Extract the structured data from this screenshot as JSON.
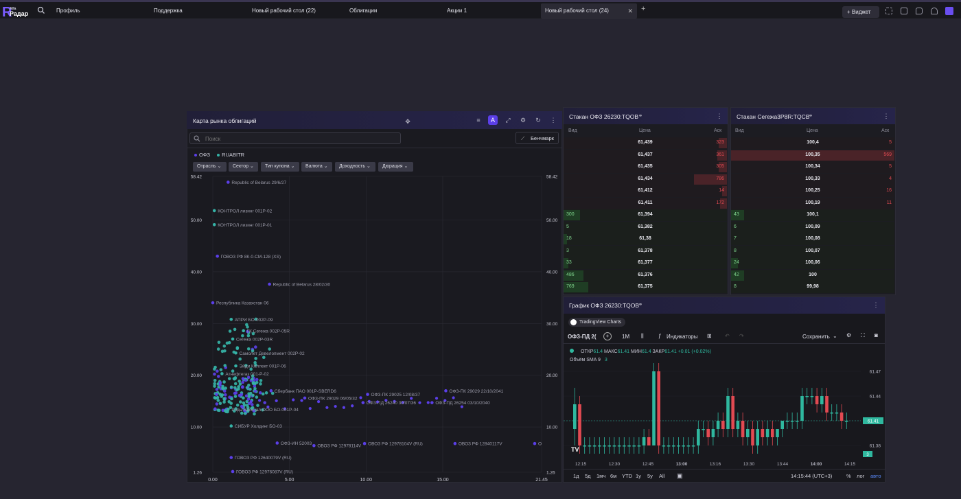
{
  "topbar": {
    "logo_small": "Alfa",
    "logo_big": "Радар",
    "tabs": [
      {
        "label": "Профиль",
        "active": false
      },
      {
        "label": "Поддержка",
        "active": false
      },
      {
        "label": "Новый рабочий стол (22)",
        "active": false
      },
      {
        "label": "Облигации",
        "active": false
      },
      {
        "label": "Акции 1",
        "active": false
      },
      {
        "label": "Новый рабочий стол (24)",
        "active": true
      }
    ],
    "add_tab": "+",
    "widget_button": "+  Виджет"
  },
  "bond_map": {
    "title": "Карта рынка облигаций",
    "search_placeholder": "Поиск",
    "benchmark_label": "Бенчмарк",
    "legend": [
      {
        "name": "ОФЗ",
        "color": "#5b3fe8"
      },
      {
        "name": "RUABITR",
        "color": "#35b2a6"
      }
    ],
    "filters": [
      "Отрасль",
      "Сектор",
      "Тип купона",
      "Валюта",
      "Доходность",
      "Дюрация"
    ]
  },
  "chart_data": {
    "type": "scatter",
    "title": "Карта рынка облигаций",
    "xlim": [
      0,
      21.45
    ],
    "ylim": [
      1.26,
      58.42
    ],
    "x_ticks": [
      "0.00",
      "5.00",
      "10.00",
      "15.00",
      "21.45"
    ],
    "y_ticks": [
      "1.26",
      "10.00",
      "20.00",
      "30.00",
      "40.00",
      "50.00",
      "58.42"
    ],
    "grid": true,
    "series": [
      {
        "name": "ОФЗ",
        "color": "#5b3fe8"
      },
      {
        "name": "RUABITR",
        "color": "#35b2a6"
      }
    ],
    "labeled_points": [
      {
        "x": 1.0,
        "y": 57.3,
        "label": "Republic of Belarus 29/6/27",
        "series": 0
      },
      {
        "x": 0.1,
        "y": 51.8,
        "label": "КОНТРОЛ лизинг 001Р-02",
        "series": 1
      },
      {
        "x": 0.1,
        "y": 49.1,
        "label": "КОНТРОЛ лизинг 001Р-01",
        "series": 1
      },
      {
        "x": 0.3,
        "y": 43.0,
        "label": "ГОВОЗ РФ 8К-0-СМ-128 (XS)",
        "series": 0
      },
      {
        "x": 3.7,
        "y": 37.6,
        "label": "Republic of Belarus 28/02/30",
        "series": 0
      },
      {
        "x": 0.0,
        "y": 34.0,
        "label": "Республика Казахстан 06",
        "series": 0
      },
      {
        "x": 1.2,
        "y": 30.8,
        "label": "АПРИ БО-002Р-09",
        "series": 1
      },
      {
        "x": 2.0,
        "y": 28.6,
        "label": "ГК Сегежа 002Р-05R",
        "series": 1
      },
      {
        "x": 1.3,
        "y": 27.0,
        "label": "Сегежа 002Р-03R",
        "series": 1
      },
      {
        "x": 1.5,
        "y": 24.3,
        "label": "Самолет Девелопмент 002Р-02",
        "series": 1
      },
      {
        "x": 1.5,
        "y": 21.8,
        "label": "Эйди Коллект 001Р-06",
        "series": 1
      },
      {
        "x": 0.6,
        "y": 20.3,
        "label": "Атнефтегаз 001-Р-02",
        "series": 1
      },
      {
        "x": 3.8,
        "y": 17.0,
        "label": "Сбербанк ПАО 001Р-SBERD6",
        "series": 0
      },
      {
        "x": 6.0,
        "y": 15.6,
        "label": "ОФЗ-ПК 29029 06/05/32",
        "series": 0
      },
      {
        "x": 10.1,
        "y": 16.3,
        "label": "ОФЗ-ПК 29025 12/08/37",
        "series": 0
      },
      {
        "x": 15.2,
        "y": 17.0,
        "label": "ОФЗ-ПК 29029 22/10/2041",
        "series": 0
      },
      {
        "x": 9.8,
        "y": 14.7,
        "label": "ОФЗ-ПД 26240 30/07/36",
        "series": 0
      },
      {
        "x": 14.3,
        "y": 14.7,
        "label": "ОФЗ-ПД 26254 03/10/2040",
        "series": 0
      },
      {
        "x": 1.0,
        "y": 13.4,
        "label": "Ряды Капитал ООО БО-001Р-04",
        "series": 1
      },
      {
        "x": 1.2,
        "y": 10.2,
        "label": "СИБУР Холдинг БО-03",
        "series": 1
      },
      {
        "x": 4.2,
        "y": 6.9,
        "label": "ОФЗ-ИН 52003",
        "series": 0
      },
      {
        "x": 6.6,
        "y": 6.4,
        "label": "ОВОЗ РФ 12978114V",
        "series": 0
      },
      {
        "x": 9.9,
        "y": 6.8,
        "label": "ОВОЗ РФ 12978104V (RU)",
        "series": 0
      },
      {
        "x": 15.8,
        "y": 6.8,
        "label": "ОВОЗ РФ 12840117V",
        "series": 0
      },
      {
        "x": 21.0,
        "y": 6.8,
        "label": "О",
        "series": 0
      },
      {
        "x": 1.2,
        "y": 4.1,
        "label": "ГОВОЗ РФ 12640079V (RU)",
        "series": 0
      },
      {
        "x": 1.3,
        "y": 1.4,
        "label": "ГОВОЗ РФ 12976087V (RU)",
        "series": 0
      }
    ]
  },
  "orderbook1": {
    "title": "Стакан ОФЗ 26230:TQOB",
    "headers": {
      "bid": "Вид",
      "price": "Цена",
      "ask": "Аск"
    },
    "asks": [
      {
        "price": "61,439",
        "ask": "323",
        "frac": 0.05
      },
      {
        "price": "61,437",
        "ask": "361",
        "frac": 0.06
      },
      {
        "price": "61,435",
        "ask": "305",
        "frac": 0.05
      },
      {
        "price": "61,434",
        "ask": "786",
        "frac": 0.2
      },
      {
        "price": "61,412",
        "ask": "14",
        "frac": 0.03
      },
      {
        "price": "61,411",
        "ask": "172",
        "frac": 0.04
      }
    ],
    "bids": [
      {
        "price": "61,394",
        "bid": "300",
        "frac": 0.1
      },
      {
        "price": "61,382",
        "bid": "5",
        "frac": 0.0
      },
      {
        "price": "61,38",
        "bid": "18",
        "frac": 0.02
      },
      {
        "price": "61,378",
        "bid": "3",
        "frac": 0.0
      },
      {
        "price": "61,377",
        "bid": "33",
        "frac": 0.03
      },
      {
        "price": "61,376",
        "bid": "486",
        "frac": 0.12
      },
      {
        "price": "61,375",
        "bid": "769",
        "frac": 0.15
      }
    ]
  },
  "orderbook2": {
    "title": "Стакан Сегежа3Р8R:TQCB",
    "headers": {
      "bid": "Вид",
      "price": "Цена",
      "ask": "Аск"
    },
    "asks": [
      {
        "price": "100,4",
        "ask": "5",
        "frac": 0.0
      },
      {
        "price": "100,35",
        "ask": "569",
        "frac": 1.0
      },
      {
        "price": "100,34",
        "ask": "5",
        "frac": 0.0
      },
      {
        "price": "100,33",
        "ask": "4",
        "frac": 0.0
      },
      {
        "price": "100,25",
        "ask": "16",
        "frac": 0.0
      },
      {
        "price": "100,19",
        "ask": "11",
        "frac": 0.0
      }
    ],
    "bids": [
      {
        "price": "100,1",
        "bid": "43",
        "frac": 0.08
      },
      {
        "price": "100,09",
        "bid": "6",
        "frac": 0.0
      },
      {
        "price": "100,08",
        "bid": "7",
        "frac": 0.0
      },
      {
        "price": "100,07",
        "bid": "8",
        "frac": 0.0
      },
      {
        "price": "100,06",
        "bid": "24",
        "frac": 0.04
      },
      {
        "price": "100",
        "bid": "42",
        "frac": 0.08
      },
      {
        "price": "99,98",
        "bid": "8",
        "frac": 0.0
      }
    ]
  },
  "price_chart": {
    "title": "График ОФЗ 26230:TQOB",
    "badge": "TradingView Charts",
    "symbol": "ОФЗ-ПД 2(",
    "interval": "1M",
    "indicators": "Индикаторы",
    "save": "Сохранить",
    "ohlc": {
      "open_label": "ОТКР",
      "open": "61.4",
      "high_label": "МАКС",
      "high": "61.41",
      "low_label": "МИН",
      "low": "61.4",
      "close_label": "ЗАКР",
      "close": "61.41",
      "change": "+0.01 (+0.02%)"
    },
    "volume_label": "Объём",
    "sma_label": "SMA 9",
    "sma_value": "3",
    "y_ticks": [
      "61.47",
      "61.44",
      "61.41",
      "61.38"
    ],
    "last_price": "61.41",
    "volume_tag": "3",
    "x_ticks": [
      "12:15",
      "12:30",
      "12:45",
      "13:00",
      "13:16",
      "13:30",
      "13:44",
      "14:00",
      "14:15"
    ],
    "periods": [
      "1д",
      "5д",
      "1мч",
      "6м",
      "YTD",
      "1у",
      "5у",
      "All"
    ],
    "time": "14:15:44 (UTC+3)",
    "percent": "%",
    "log": "лог",
    "auto": "авто",
    "tv_logo": "TV",
    "candle_up": "#2fb89f",
    "candle_down": "#e24a52"
  }
}
